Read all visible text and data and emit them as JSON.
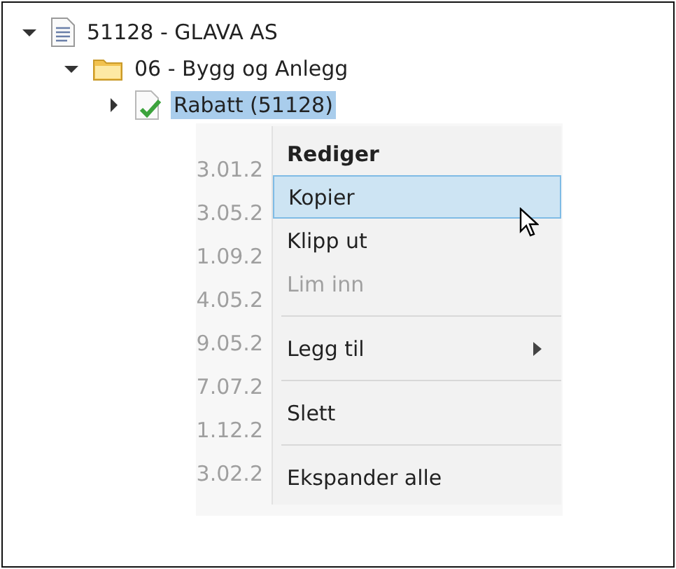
{
  "tree": [
    {
      "label": "51128 - GLAVA AS",
      "kind": "document",
      "expanded": true,
      "selected": false,
      "children": [
        {
          "label": "06 - Bygg og Anlegg",
          "kind": "folder",
          "expanded": true,
          "selected": false,
          "children": [
            {
              "label": "Rabatt (51128)",
              "kind": "approved",
              "expanded": false,
              "selected": true
            }
          ]
        }
      ]
    }
  ],
  "background_dates": [
    "3.01.2",
    "3.05.2",
    "1.09.2",
    "4.05.2",
    "9.05.2",
    "7.07.2",
    "1.12.2",
    "3.02.2"
  ],
  "context_menu": [
    {
      "kind": "item",
      "label": "Rediger",
      "bold": true,
      "disabled": false,
      "selected": false
    },
    {
      "kind": "item",
      "label": "Kopier",
      "bold": false,
      "disabled": false,
      "selected": true
    },
    {
      "kind": "item",
      "label": "Klipp ut",
      "bold": false,
      "disabled": false,
      "selected": false
    },
    {
      "kind": "item",
      "label": "Lim inn",
      "bold": false,
      "disabled": true,
      "selected": false
    },
    {
      "kind": "separator"
    },
    {
      "kind": "submenu",
      "label": "Legg til",
      "bold": false,
      "disabled": false,
      "selected": false
    },
    {
      "kind": "separator"
    },
    {
      "kind": "item",
      "label": "Slett",
      "bold": false,
      "disabled": false,
      "selected": false
    },
    {
      "kind": "separator"
    },
    {
      "kind": "item",
      "label": "Ekspander alle",
      "bold": false,
      "disabled": false,
      "selected": false
    }
  ]
}
